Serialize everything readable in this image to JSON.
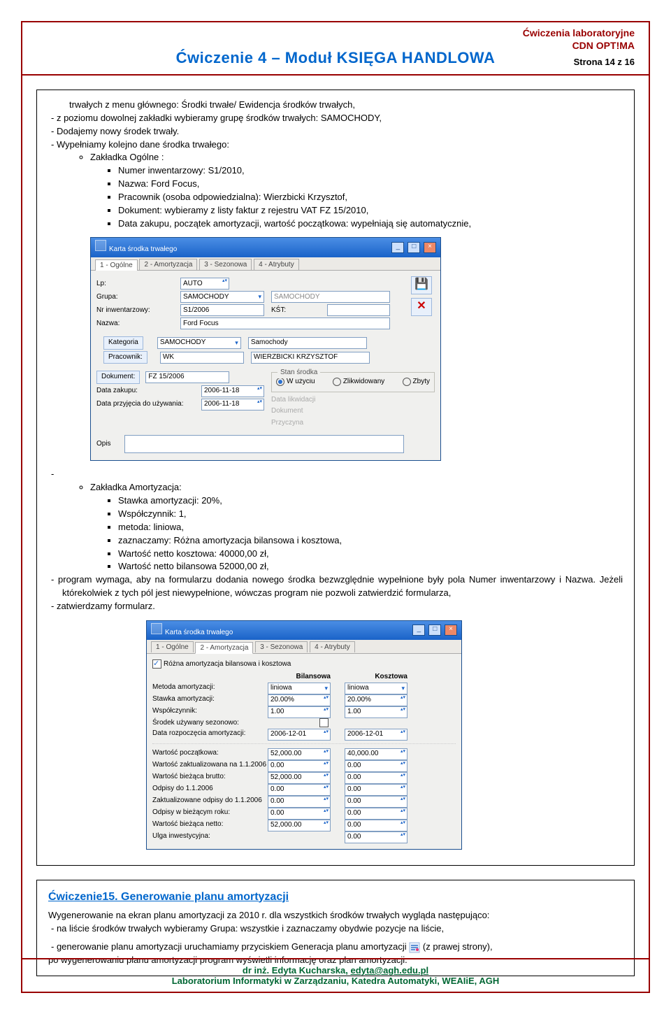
{
  "header": {
    "lab": "Ćwiczenia laboratoryjne",
    "product": "CDN OPT!MA",
    "title": "Ćwiczenie 4 – Moduł KSIĘGA HANDLOWA",
    "page": "Strona 14 z 16"
  },
  "box1": {
    "intro": "trwałych z menu głównego: Środki trwałe/ Ewidencja środków trwałych,",
    "dash1": "z poziomu dowolnej zakładki wybieramy grupę środków trwałych: SAMOCHODY,",
    "dash2": "Dodajemy nowy środek trwały.",
    "dash3": "Wypełniamy kolejno dane środka trwałego:",
    "circle1": "Zakładka Ogólne :",
    "sq1": "Numer inwentarzowy: S1/2010,",
    "sq2": "Nazwa: Ford Focus,",
    "sq3": "Pracownik (osoba odpowiedzialna): Wierzbicki Krzysztof,",
    "sq4": "Dokument: wybieramy z listy faktur z rejestru VAT FZ 15/2010,",
    "sq5": "Data zakupu, początek amortyzacji, wartość początkowa: wypełniają się automatycznie,",
    "circle2": "Zakładka Amortyzacja:",
    "sq6": "Stawka amortyzacji: 20%,",
    "sq7": "Współczynnik: 1,",
    "sq8": "metoda: liniowa,",
    "sq9": "zaznaczamy: Różna amortyzacja bilansowa i kosztowa,",
    "sq10": "Wartość netto kosztowa: 40000,00 zł,",
    "sq11": "Wartość netto bilansowa 52000,00 zł,",
    "dash4": "program wymaga, aby na formularzu dodania nowego środka bezwzględnie wypełnione były pola Numer inwentarzowy i Nazwa. Jeżeli którekolwiek z tych pól jest niewypełnione, wówczas program nie pozwoli zatwierdzić formularza,",
    "dash5": "zatwierdzamy formularz."
  },
  "sshot1": {
    "title": "Karta środka trwałego",
    "tabs": [
      "1 - Ogólne",
      "2 - Amortyzacja",
      "3 - Sezonowa",
      "4 - Atrybuty"
    ],
    "lp_label": "Lp:",
    "lp_val": "AUTO",
    "grupa_label": "Grupa:",
    "grupa_val": "SAMOCHODY",
    "grupa_val2": "SAMOCHODY",
    "nrinw_label": "Nr inwentarzowy:",
    "nrinw_val": "S1/2006",
    "kst_label": "KŚT:",
    "nazwa_label": "Nazwa:",
    "nazwa_val": "Ford Focus",
    "kategoria_btn": "Kategoria",
    "kategoria_val": "SAMOCHODY",
    "kategoria_val2": "Samochody",
    "prac_btn": "Pracownik:",
    "prac_val": "WK",
    "prac_val2": "WIERZBICKI KRZYSZTOF",
    "dok_btn": "Dokument:",
    "dok_val": "FZ 15/2006",
    "stan_legend": "Stan środka",
    "stan_opt1": "W użyciu",
    "stan_opt2": "Zlikwidowany",
    "stan_opt3": "Zbyty",
    "dz_label": "Data zakupu:",
    "dz_val": "2006-11-18",
    "du_label": "Data przyjęcia do używania:",
    "du_val": "2006-11-18",
    "dl_label": "Data likwidacji",
    "dokl_label": "Dokument",
    "przyczyna_label": "Przyczyna",
    "opis_label": "Opis"
  },
  "sshot2": {
    "title": "Karta środka trwałego",
    "tabs": [
      "1 - Ogólne",
      "2 - Amortyzacja",
      "3 - Sezonowa",
      "4 - Atrybuty"
    ],
    "chk1": "Różna amortyzacja bilansowa i kosztowa",
    "col1": "Bilansowa",
    "col2": "Kosztowa",
    "r1": "Metoda amortyzacji:",
    "r1v1": "liniowa",
    "r1v2": "liniowa",
    "r2": "Stawka amortyzacji:",
    "r2v1": "20.00%",
    "r2v2": "20.00%",
    "r3": "Współczynnik:",
    "r3v1": "1.00",
    "r3v2": "1.00",
    "r4": "Środek używany sezonowo:",
    "r5": "Data rozpoczęcia amortyzacji:",
    "r5v1": "2006-12-01",
    "r5v2": "2006-12-01",
    "r6": "Wartość początkowa:",
    "r6v1": "52,000.00",
    "r6v2": "40,000.00",
    "r7": "Wartość zaktualizowana na 1.1.2006",
    "r7v1": "0.00",
    "r7v2": "0.00",
    "r8": "Wartość bieżąca brutto:",
    "r8v1": "52,000.00",
    "r8v2": "0.00",
    "r9": "Odpisy do 1.1.2006",
    "r9v1": "0.00",
    "r9v2": "0.00",
    "r10": "Zaktualizowane odpisy do 1.1.2006",
    "r10v1": "0.00",
    "r10v2": "0.00",
    "r11": "Odpisy w bieżącym roku:",
    "r11v1": "0.00",
    "r11v2": "0.00",
    "r12": "Wartość bieżąca netto:",
    "r12v1": "52,000.00",
    "r12v2": "0.00",
    "r13": "Ulga inwestycyjna:",
    "r13v": "0.00"
  },
  "box2": {
    "title": "Ćwiczenie15. Generowanie planu amortyzacji",
    "p1": "Wygenerowanie na ekran planu amortyzacji za 2010 r. dla wszystkich środków trwałych wygląda następująco:",
    "d1": "na liście środków trwałych wybieramy Grupa: wszystkie i zaznaczamy obydwie pozycje na liście,",
    "d2a": "generowanie planu amortyzacji uruchamiamy przyciskiem Generacja planu amortyzacji",
    "d2b": "(z prawej strony),",
    "p2": "po wygenerowaniu planu amortyzacji program wyświetli informację oraz plan amortyzacji."
  },
  "footer": {
    "line1a": "dr inż. Edyta Kucharska, ",
    "line1b": "edyta@agh.edu.pl",
    "line2": "Laboratorium Informatyki w Zarządzaniu, Katedra Automatyki, WEAIiE, AGH"
  }
}
